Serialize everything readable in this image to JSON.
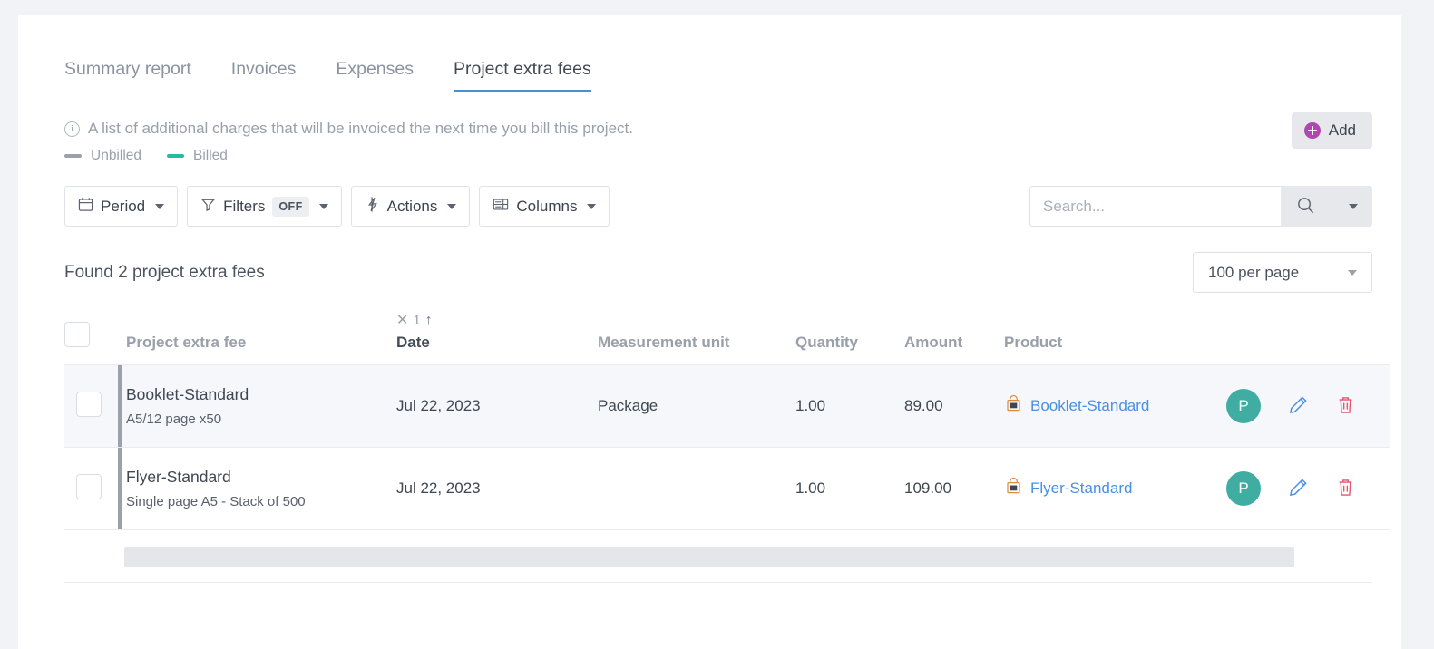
{
  "tabs": [
    {
      "label": "Summary report",
      "active": false
    },
    {
      "label": "Invoices",
      "active": false
    },
    {
      "label": "Expenses",
      "active": false
    },
    {
      "label": "Project extra fees",
      "active": true
    }
  ],
  "info": {
    "text": "A list of additional charges that will be invoiced the next time you bill this project.",
    "icon": "info-circle-icon",
    "legend": [
      {
        "label": "Unbilled",
        "color": "#9aa1aa"
      },
      {
        "label": "Billed",
        "color": "#27b9a8"
      }
    ]
  },
  "header_actions": {
    "add_label": "Add",
    "add_icon": "plus-circle-icon"
  },
  "toolbar": {
    "buttons": [
      {
        "label": "Period",
        "icon": "calendar-icon",
        "badge": null
      },
      {
        "label": "Filters",
        "icon": "funnel-icon",
        "badge": "OFF"
      },
      {
        "label": "Actions",
        "icon": "lightning-icon",
        "badge": null
      },
      {
        "label": "Columns",
        "icon": "columns-icon",
        "badge": null
      }
    ],
    "search": {
      "value": "",
      "placeholder": "Search...",
      "search_icon": "magnifier-icon",
      "dropdown_icon": "chevron-down-icon"
    }
  },
  "results": {
    "found_text": "Found 2 project extra fees",
    "per_page": "100 per page"
  },
  "table": {
    "sort": {
      "index": "1",
      "clear_icon": "close-icon",
      "direction_icon": "arrow-up-icon",
      "column": "Date"
    },
    "headers": {
      "select_all": "select-all-checkbox",
      "name": "Project extra fee",
      "date": "Date",
      "unit": "Measurement unit",
      "quantity": "Quantity",
      "amount": "Amount",
      "product": "Product"
    },
    "rows": [
      {
        "name": "Booklet-Standard",
        "description": "A5/12 page x50",
        "date": "Jul 22, 2023",
        "unit": "Package",
        "quantity": "1.00",
        "amount": "89.00",
        "product": "Booklet-Standard",
        "avatar": "P",
        "highlighted": true
      },
      {
        "name": "Flyer-Standard",
        "description": "Single page A5 - Stack of 500",
        "date": "Jul 22, 2023",
        "unit": "",
        "quantity": "1.00",
        "amount": "109.00",
        "product": "Flyer-Standard",
        "avatar": "P",
        "highlighted": false
      }
    ],
    "row_icons": {
      "product": "shopping-bag-icon",
      "edit": "pencil-icon",
      "delete": "trash-icon"
    }
  },
  "colors": {
    "accent_blue": "#4a8fd0",
    "link_blue": "#4a90e2",
    "add_purple": "#b046b0",
    "avatar_teal": "#3fada1",
    "edit_blue": "#4a90e2",
    "delete_red": "#e8526f",
    "billed_teal": "#27b9a8",
    "unbilled_gray": "#9aa1aa"
  }
}
